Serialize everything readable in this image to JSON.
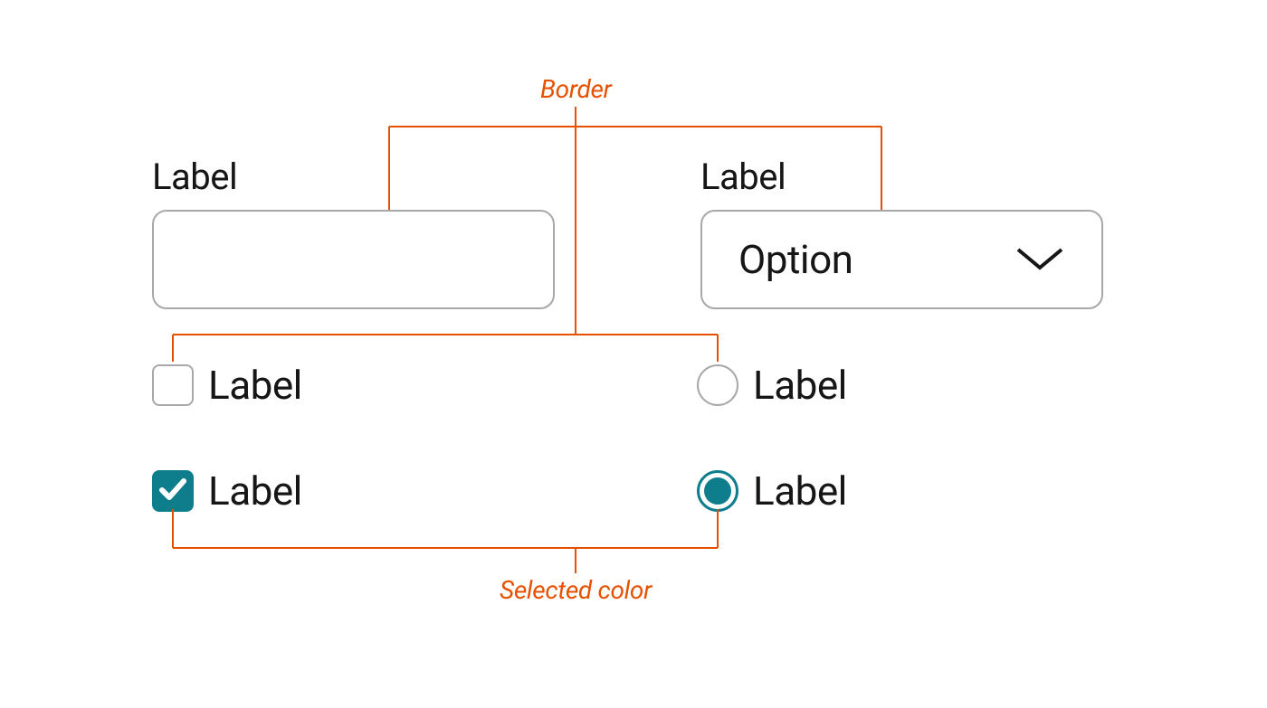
{
  "annotations": {
    "border": "Border",
    "selected_color": "Selected color"
  },
  "left": {
    "label": "Label",
    "checkbox_unchecked": {
      "label": "Label"
    },
    "checkbox_checked": {
      "label": "Label"
    }
  },
  "right": {
    "label": "Label",
    "dropdown": {
      "value": "Option"
    },
    "radio_unselected": {
      "label": "Label"
    },
    "radio_selected": {
      "label": "Label"
    }
  },
  "colors": {
    "accent": "#e65100",
    "selected": "#0e7d8c",
    "border_gray": "#a8a8a8"
  }
}
